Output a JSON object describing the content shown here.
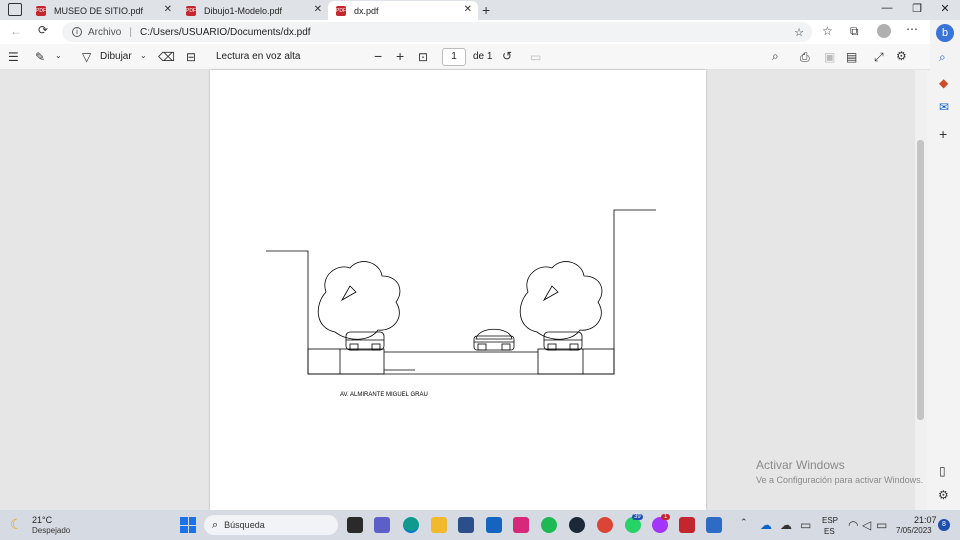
{
  "tabs": [
    {
      "title": "MUSEO DE SITIO.pdf",
      "active": false
    },
    {
      "title": "Dibujo1-Modelo.pdf",
      "active": false
    },
    {
      "title": "dx.pdf",
      "active": true
    }
  ],
  "address": {
    "site_label": "Archivo",
    "url": "C:/Users/USUARIO/Documents/dx.pdf"
  },
  "pdf_toolbar": {
    "draw_label": "Dibujar",
    "read_aloud_label": "Lectura en voz alta",
    "page_current": "1",
    "page_total_label": "de 1"
  },
  "document": {
    "caption": "AV. ALMIRANTE MIGUEL GRAU"
  },
  "watermark": {
    "title": "Activar Windows",
    "subtitle": "Ve a Configuración para activar Windows."
  },
  "taskbar": {
    "weather_temp": "21°C",
    "weather_desc": "Despejado",
    "search_label": "Búsqueda",
    "lang_top": "ESP",
    "lang_bottom": "ES",
    "time": "21:07",
    "date": "7/05/2023",
    "notifications_count": "8",
    "badge_39": "39",
    "badge_1": "1"
  },
  "colors": {
    "pdf_red": "#c4262e",
    "edge_blue": "#0078d4",
    "notification_blue": "#1e4fae"
  }
}
